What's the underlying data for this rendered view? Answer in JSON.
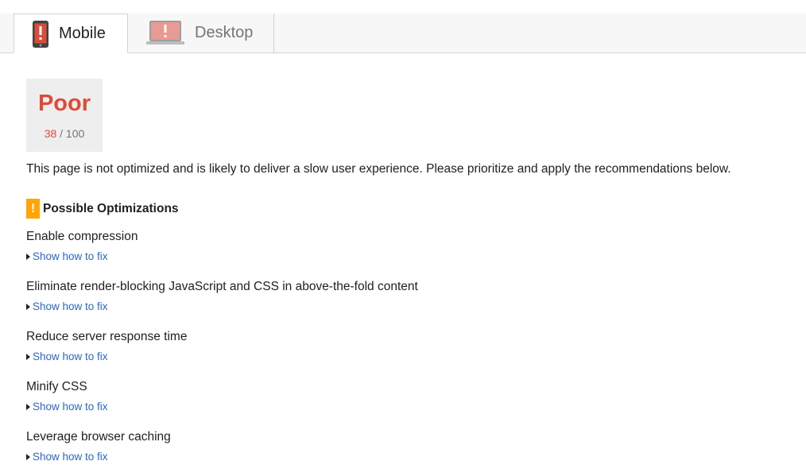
{
  "tabs": [
    {
      "label": "Mobile",
      "icon": "phone-warning-icon",
      "active": true
    },
    {
      "label": "Desktop",
      "icon": "laptop-warning-icon",
      "active": false
    }
  ],
  "score": {
    "label": "Poor",
    "value": "38",
    "max": "/ 100"
  },
  "summary": "This page is not optimized and is likely to deliver a slow user experience. Please prioritize and apply the recommendations below.",
  "section": {
    "warn_glyph": "!",
    "title": "Possible Optimizations"
  },
  "optimizations": [
    {
      "title": "Enable compression",
      "link": "Show how to fix"
    },
    {
      "title": "Eliminate render-blocking JavaScript and CSS in above-the-fold content",
      "link": "Show how to fix"
    },
    {
      "title": "Reduce server response time",
      "link": "Show how to fix"
    },
    {
      "title": "Minify CSS",
      "link": "Show how to fix"
    },
    {
      "title": "Leverage browser caching",
      "link": "Show how to fix"
    }
  ],
  "colors": {
    "poor": "#dd4b39",
    "warning": "#ffa400",
    "link": "#2a67c8",
    "icon_red": "#dd4b39",
    "icon_pink": "#e89a94"
  }
}
